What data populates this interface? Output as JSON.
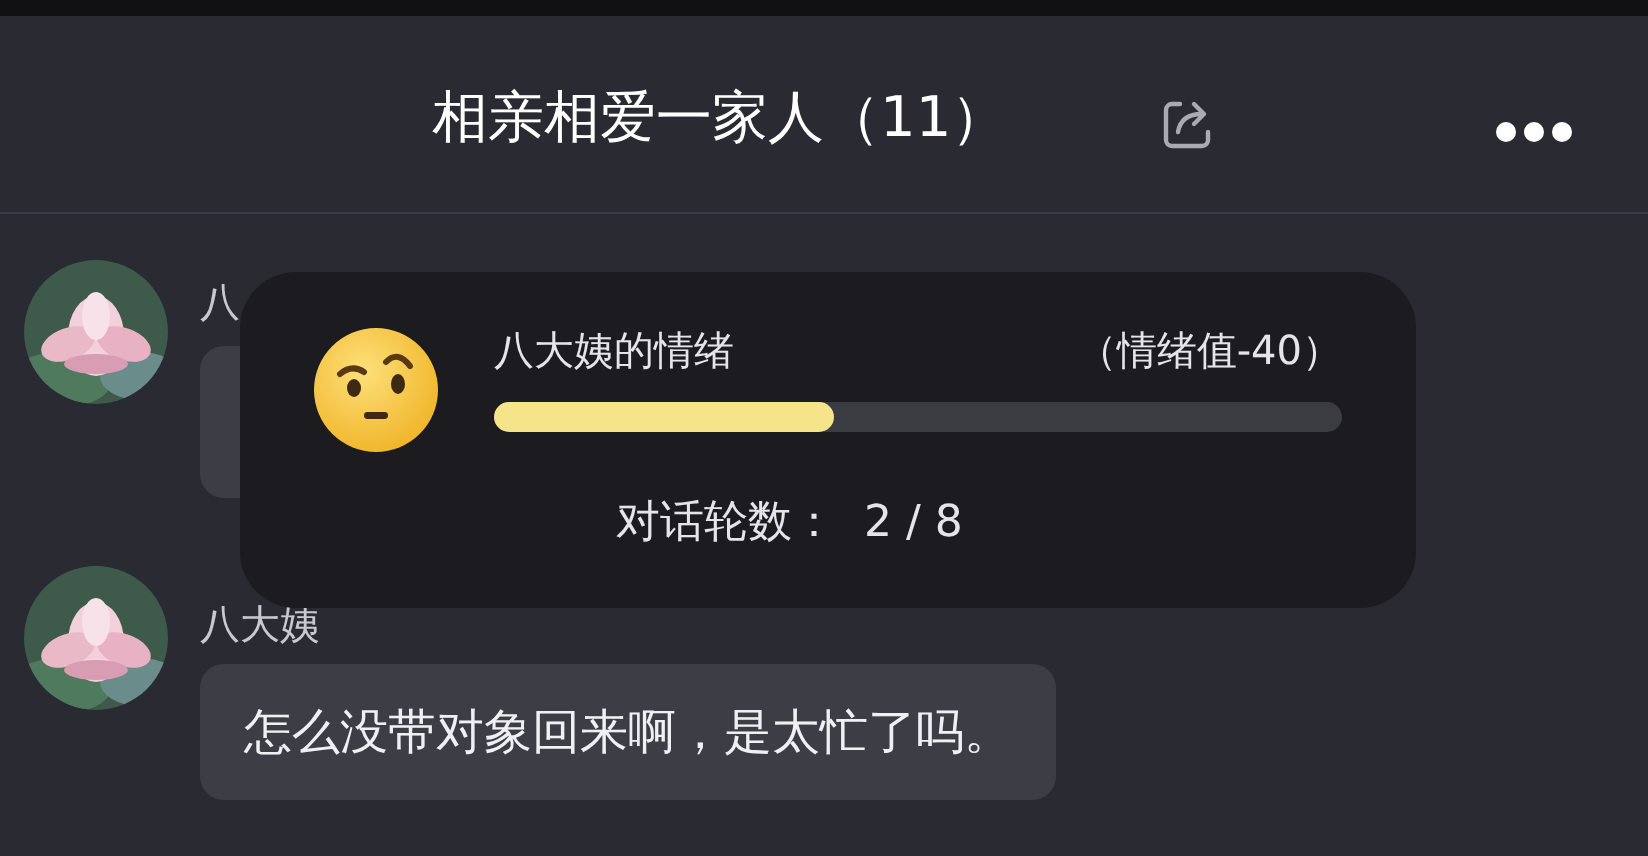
{
  "header": {
    "title": "相亲相爱一家人（11）"
  },
  "messages": [
    {
      "sender": "八",
      "text_visible": false
    },
    {
      "sender": "八大姨",
      "text": "怎么没带对象回来啊，是太忙了吗。"
    }
  ],
  "mood_popup": {
    "title": "八大姨的情绪",
    "value": "（情绪值-40）",
    "level": 0.4,
    "rounds": "对话轮数：  2 / 8"
  }
}
